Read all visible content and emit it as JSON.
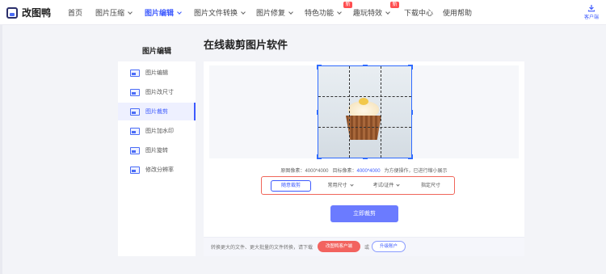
{
  "app": {
    "logo_text": "改图鸭"
  },
  "nav": {
    "items": [
      {
        "label": "首页"
      },
      {
        "label": "图片压缩"
      },
      {
        "label": "图片编辑"
      },
      {
        "label": "图片文件转换"
      },
      {
        "label": "图片修复"
      },
      {
        "label": "特色功能"
      },
      {
        "label": "趣玩特效"
      },
      {
        "label": "下载中心"
      },
      {
        "label": "使用帮助"
      }
    ],
    "badge_text": "新",
    "client_label": "客户端"
  },
  "sidebar": {
    "title": "图片编辑",
    "items": [
      {
        "label": "图片编辑"
      },
      {
        "label": "图片改尺寸"
      },
      {
        "label": "图片裁剪"
      },
      {
        "label": "图片加水印"
      },
      {
        "label": "图片旋转"
      },
      {
        "label": "修改分辨率"
      }
    ],
    "active_index": 2
  },
  "main": {
    "title": "在线裁剪图片软件",
    "info": {
      "original_label": "原图像素：",
      "original_value": "4000*4000",
      "target_label": "目标像素：",
      "target_value": "4000*4000",
      "note": "为方便操作，已进行缩小展示"
    },
    "options": [
      {
        "label": "随意裁剪"
      },
      {
        "label": "常用尺寸"
      },
      {
        "label": "考试/证件"
      },
      {
        "label": "指定尺寸"
      }
    ],
    "crop_button": "立即裁剪"
  },
  "footer": {
    "text": "转换更大的文件、更大批量的文件转换，请下载",
    "download_button": "改图鸭客户端",
    "or_text": "或",
    "upgrade_button": "升级账户"
  },
  "colors": {
    "accent": "#3d5afe",
    "crop_button": "#6b7bff",
    "download_button": "#f2635f",
    "option_border": "#f0665a"
  }
}
